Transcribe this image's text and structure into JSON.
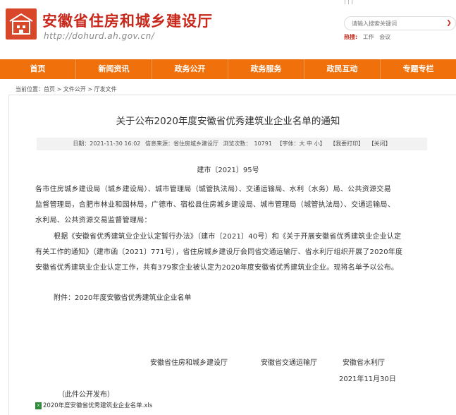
{
  "header": {
    "site_title": "安徽省住房和城乡建设厅",
    "site_url": "http://dohurd.ah.gov.cn/",
    "top_links": "|   |   |",
    "search_placeholder": "请输入搜索关键词",
    "hot_label": "热搜:",
    "hot_words": [
      "工作",
      "会议"
    ]
  },
  "nav": {
    "items": [
      "首页",
      "新闻资讯",
      "政务公开",
      "政务服务",
      "政民互动",
      "专题专栏"
    ]
  },
  "breadcrumb": "当前位置：首页 > 文件公开 > 厅发文件",
  "article": {
    "title": "关于公布2020年度安徽省优秀建筑业企业名单的通知",
    "meta": {
      "date": "日期：2021-11-30 16:02",
      "source": "信息来源：省住房城乡建设厅",
      "views_label": "浏览次数：",
      "views": "10791",
      "font": "【字体：大 中 小】",
      "print": "【我要打印】",
      "close": "【关闭】"
    },
    "doc_no": "建市〔2021〕95号",
    "recipients_1": "各市住房城乡建设局（城乡建设局）、城市管理局（城管执法局）、交通运输局、水利（水务）局、公共资源交易",
    "recipients_2": "监督管理局，合肥市林业和园林局，广德市、宿松县住房城乡建设局、城市管理局（城管执法局）、交通运输局、",
    "recipients_3": "水利局、公共资源交易监督管理局：",
    "body_1": "根据《安徽省优秀建筑业企业认定暂行办法》（建市〔2021〕40号）和《关于开展安徽省优秀建筑业企业认定",
    "body_2": "有关工作的通知》（建市函〔2021〕771号），省住房城乡建设厅会同省交通运输厅、省水利厅组织开展了2020年度",
    "body_3": "安徽省优秀建筑业企业认定工作，共有379家企业被认定为2020年度安徽省优秀建筑业企业。现将名单予以公布。",
    "attachment": "附件：2020年度安徽省优秀建筑业企业名单",
    "signers": [
      "安徽省住房和城乡建设厅",
      "安徽省交通运输厅",
      "安徽省水利厅"
    ],
    "sign_date": "2021年11月30日",
    "public_note": "（此件公开发布）",
    "file_link": "2020年度安徽省优秀建筑业企业名单.xls"
  }
}
